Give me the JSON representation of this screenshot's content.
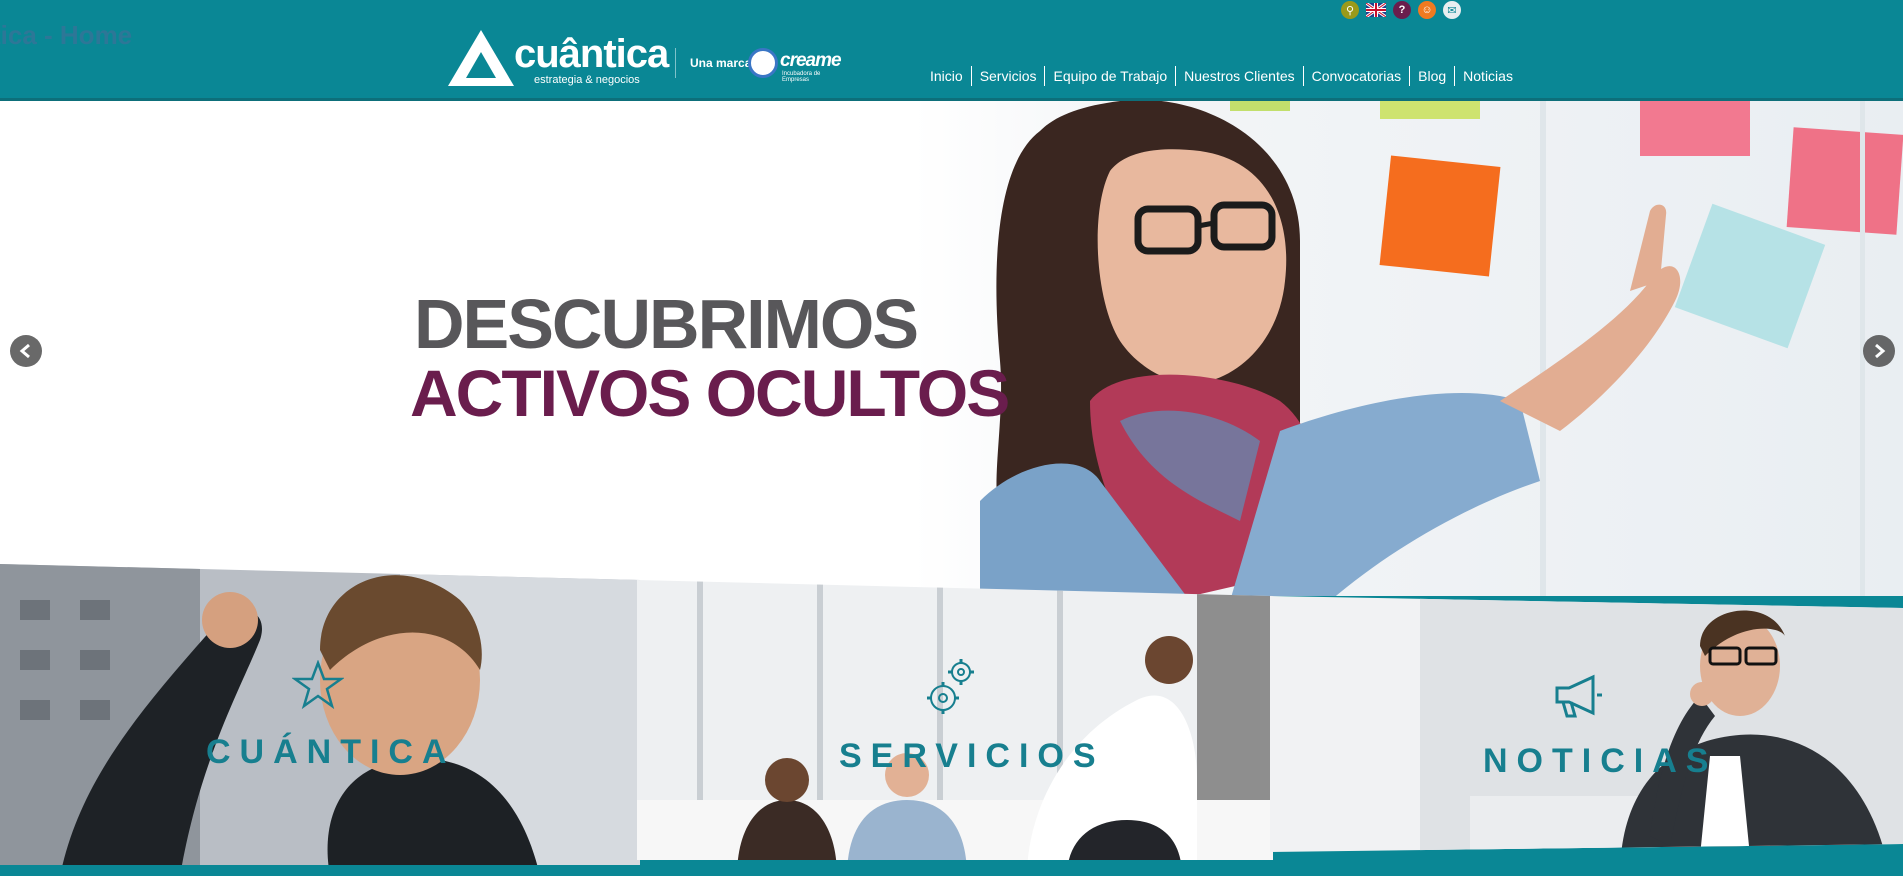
{
  "browser_tab_title": "tica - Home",
  "header": {
    "logo_brand": "cuântica",
    "logo_tagline": "estrategia & negocios",
    "una_marca": "Una marca",
    "partner_brand": "creame",
    "partner_sub": "Incubadora de Empresas",
    "top_icons": [
      {
        "name": "search-icon",
        "color": "#9a9a1a",
        "glyph": "⚲"
      },
      {
        "name": "uk-flag-icon",
        "color": "#20418e",
        "glyph": ""
      },
      {
        "name": "help-icon",
        "color": "#6a1d4d",
        "glyph": "?"
      },
      {
        "name": "user-icon",
        "color": "#f07a21",
        "glyph": "☺"
      },
      {
        "name": "mail-icon",
        "color": "#e8eef0",
        "glyph": "✉"
      }
    ],
    "nav": [
      "Inicio",
      "Servicios",
      "Equipo de Trabajo",
      "Nuestros Clientes",
      "Convocatorias",
      "Blog",
      "Noticias"
    ]
  },
  "hero": {
    "line1": "DESCUBRIMOS",
    "line2": "ACTIVOS OCULTOS"
  },
  "panels": [
    {
      "title": "CUÁNTICA",
      "icon": "star-icon"
    },
    {
      "title": "SERVICIOS",
      "icon": "gears-icon"
    },
    {
      "title": "NOTICIAS",
      "icon": "megaphone-icon"
    }
  ],
  "colors": {
    "header_bg": "#0a8795",
    "headline_gray": "#58575a",
    "headline_purple": "#6a1d4d",
    "panel_title": "#177f8f"
  }
}
